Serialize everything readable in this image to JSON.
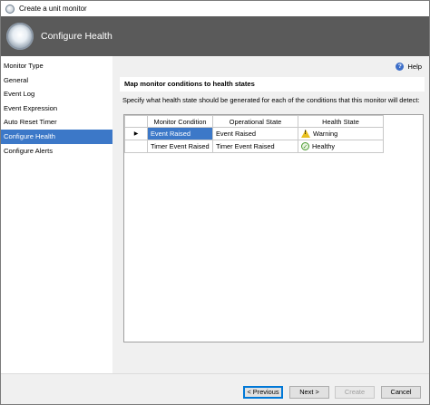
{
  "window": {
    "title": "Create a unit monitor"
  },
  "header": {
    "title": "Configure Health"
  },
  "sidebar": {
    "items": [
      {
        "label": "Monitor Type",
        "active": false
      },
      {
        "label": "General",
        "active": false
      },
      {
        "label": "Event Log",
        "active": false
      },
      {
        "label": "Event Expression",
        "active": false
      },
      {
        "label": "Auto Reset Timer",
        "active": false
      },
      {
        "label": "Configure Health",
        "active": true
      },
      {
        "label": "Configure Alerts",
        "active": false
      }
    ]
  },
  "help": {
    "label": "Help"
  },
  "section": {
    "heading": "Map monitor conditions to health states",
    "description": "Specify what health state should be generated for each of the conditions that this monitor will detect:"
  },
  "grid": {
    "columns": [
      "Monitor Condition",
      "Operational State",
      "Health State"
    ],
    "rows": [
      {
        "marker": "▶",
        "condition": "Event Raised",
        "operational": "Event Raised",
        "health": "Warning",
        "health_icon": "warning-icon"
      },
      {
        "marker": "",
        "condition": "Timer Event Raised",
        "operational": "Timer Event Raised",
        "health": "Healthy",
        "health_icon": "healthy-check-icon"
      }
    ]
  },
  "buttons": {
    "previous": "< Previous",
    "next": "Next >",
    "create": "Create",
    "cancel": "Cancel"
  },
  "colors": {
    "header_bg": "#5a5a5a",
    "selection": "#3c78c8"
  }
}
